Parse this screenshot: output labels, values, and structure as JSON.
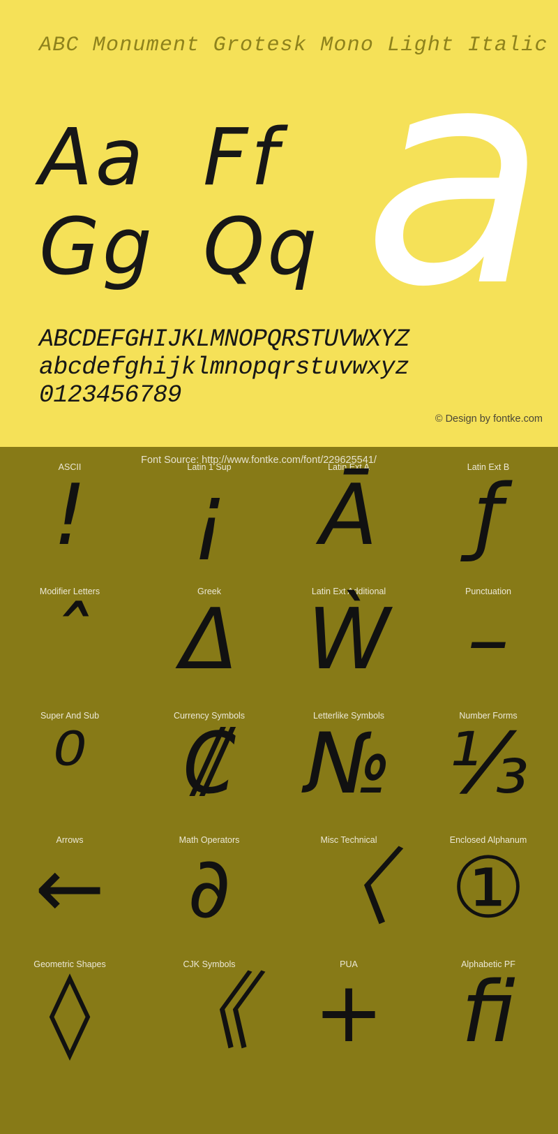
{
  "specimen": {
    "title": "ABC Monument Grotesk Mono Light Italic",
    "big_glyph": "a",
    "pairs": [
      [
        "Aa",
        "Ff"
      ],
      [
        "Gg",
        "Qq"
      ]
    ],
    "alphabet_upper": "ABCDEFGHIJKLMNOPQRSTUVWXYZ",
    "alphabet_lower": "abcdefghijklmnopqrstuvwxyz",
    "numerals": "0123456789",
    "design_credit": "© Design by fontke.com",
    "bg_color": "#f5e158",
    "title_color": "#8e821c",
    "glyph_color": "#ffffff",
    "text_color": "#171717"
  },
  "blocks": {
    "font_source": "Font Source: http://www.fontke.com/font/229625541/",
    "bg_color": "#877a17",
    "label_color": "#ece8d6",
    "glyph_color": "#111111",
    "rows": [
      [
        {
          "label": "ASCII",
          "glyph": "!"
        },
        {
          "label": "Latin 1 Sup",
          "glyph": "¡"
        },
        {
          "label": "Latin Ext A",
          "glyph": "Ā"
        },
        {
          "label": "Latin Ext B",
          "glyph": "ƒ"
        }
      ],
      [
        {
          "label": "Modifier Letters",
          "glyph": "ˆ"
        },
        {
          "label": "Greek",
          "glyph": "Δ"
        },
        {
          "label": "Latin Ext Additional",
          "glyph": "Ẁ"
        },
        {
          "label": "Punctuation",
          "glyph": "–"
        }
      ],
      [
        {
          "label": "Super And Sub",
          "glyph": "⁰"
        },
        {
          "label": "Currency Symbols",
          "glyph": "₡"
        },
        {
          "label": "Letterlike Symbols",
          "glyph": "№"
        },
        {
          "label": "Number Forms",
          "glyph": "⅓"
        }
      ],
      [
        {
          "label": "Arrows",
          "glyph": "←"
        },
        {
          "label": "Math Operators",
          "glyph": "∂"
        },
        {
          "label": "Misc Technical",
          "glyph": "〈"
        },
        {
          "label": "Enclosed Alphanum",
          "glyph": "①"
        }
      ],
      [
        {
          "label": "Geometric Shapes",
          "glyph": "◊"
        },
        {
          "label": "CJK Symbols",
          "glyph": "《"
        },
        {
          "label": "PUA",
          "glyph": "+"
        },
        {
          "label": "Alphabetic PF",
          "glyph": "ﬁ"
        }
      ]
    ]
  }
}
